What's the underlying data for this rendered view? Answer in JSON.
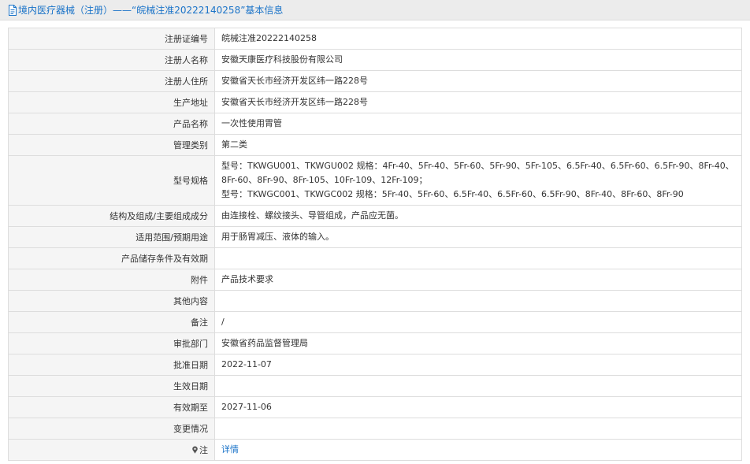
{
  "header": {
    "title": "境内医疗器械（注册）——“皖械注准20222140258”基本信息"
  },
  "rows": [
    {
      "label": "注册证编号",
      "value": "皖械注准20222140258"
    },
    {
      "label": "注册人名称",
      "value": "安徽天康医疗科技股份有限公司"
    },
    {
      "label": "注册人住所",
      "value": "安徽省天长市经济开发区纬一路228号"
    },
    {
      "label": "生产地址",
      "value": "安徽省天长市经济开发区纬一路228号"
    },
    {
      "label": "产品名称",
      "value": "一次性使用胃管"
    },
    {
      "label": "管理类别",
      "value": "第二类"
    },
    {
      "label": "型号规格",
      "value_line1": "型号：TKWGU001、TKWGU002 规格：4Fr-40、5Fr-40、5Fr-60、5Fr-90、5Fr-105、6.5Fr-40、6.5Fr-60、6.5Fr-90、8Fr-40、8Fr-60、8Fr-90、8Fr-105、10Fr-109、12Fr-109；",
      "value_line2": "型号：TKWGC001、TKWGC002 规格：5Fr-40、5Fr-60、6.5Fr-40、6.5Fr-60、6.5Fr-90、8Fr-40、8Fr-60、8Fr-90"
    },
    {
      "label": "结构及组成/主要组成成分",
      "value": "由连接栓、螺纹接头、导管组成，产品应无菌。"
    },
    {
      "label": "适用范围/预期用途",
      "value": "用于肠胃减压、液体的输入。"
    },
    {
      "label": "产品储存条件及有效期",
      "value": ""
    },
    {
      "label": "附件",
      "value": "产品技术要求"
    },
    {
      "label": "其他内容",
      "value": ""
    },
    {
      "label": "备注",
      "value": "/"
    },
    {
      "label": "审批部门",
      "value": "安徽省药品监督管理局"
    },
    {
      "label": "批准日期",
      "value": "2022-11-07"
    },
    {
      "label": "生效日期",
      "value": ""
    },
    {
      "label": "有效期至",
      "value": "2027-11-06"
    },
    {
      "label": "变更情况",
      "value": ""
    },
    {
      "label": "注",
      "value": "详情"
    }
  ],
  "icons": {
    "header_icon": "document-icon",
    "note_icon": "pin-icon"
  },
  "colors": {
    "link": "#1a73c8",
    "label_bg": "#f5f5f5",
    "border": "#dddddd"
  }
}
